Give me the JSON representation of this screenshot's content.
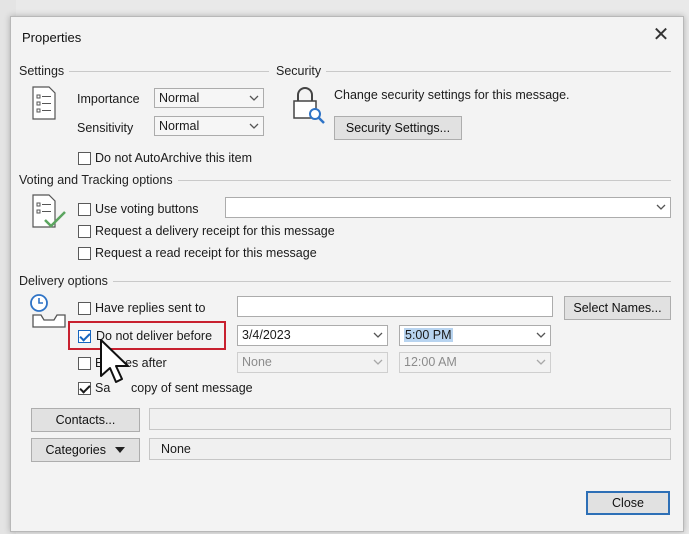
{
  "dialog": {
    "title": "Properties",
    "close_glyph": "✕"
  },
  "settings": {
    "title": "Settings",
    "importance_label": "Importance",
    "importance_value": "Normal",
    "sensitivity_label": "Sensitivity",
    "sensitivity_value": "Normal",
    "no_autoarchive_label": "Do not AutoArchive this item"
  },
  "security": {
    "title": "Security",
    "description": "Change security settings for this message.",
    "button_label": "Security Settings..."
  },
  "voting": {
    "title": "Voting and Tracking options",
    "use_voting_label": "Use voting buttons",
    "delivery_receipt_label": "Request a delivery receipt for this message",
    "read_receipt_label": "Request a read receipt for this message"
  },
  "delivery": {
    "title": "Delivery options",
    "have_replies_label": "Have replies sent to",
    "select_names_label": "Select Names...",
    "do_not_deliver_label": "Do not deliver before",
    "deliver_date": "3/4/2023",
    "deliver_time": "5:00 PM",
    "expires_label_start": "E",
    "expires_label_end": "es after",
    "expires_date": "None",
    "expires_time": "12:00 AM",
    "save_copy_label_start": "Sa",
    "save_copy_label_end": "copy of sent message"
  },
  "contacts_label": "Contacts...",
  "categories_label": "Categories",
  "categories_value": "None",
  "close_button_label": "Close"
}
